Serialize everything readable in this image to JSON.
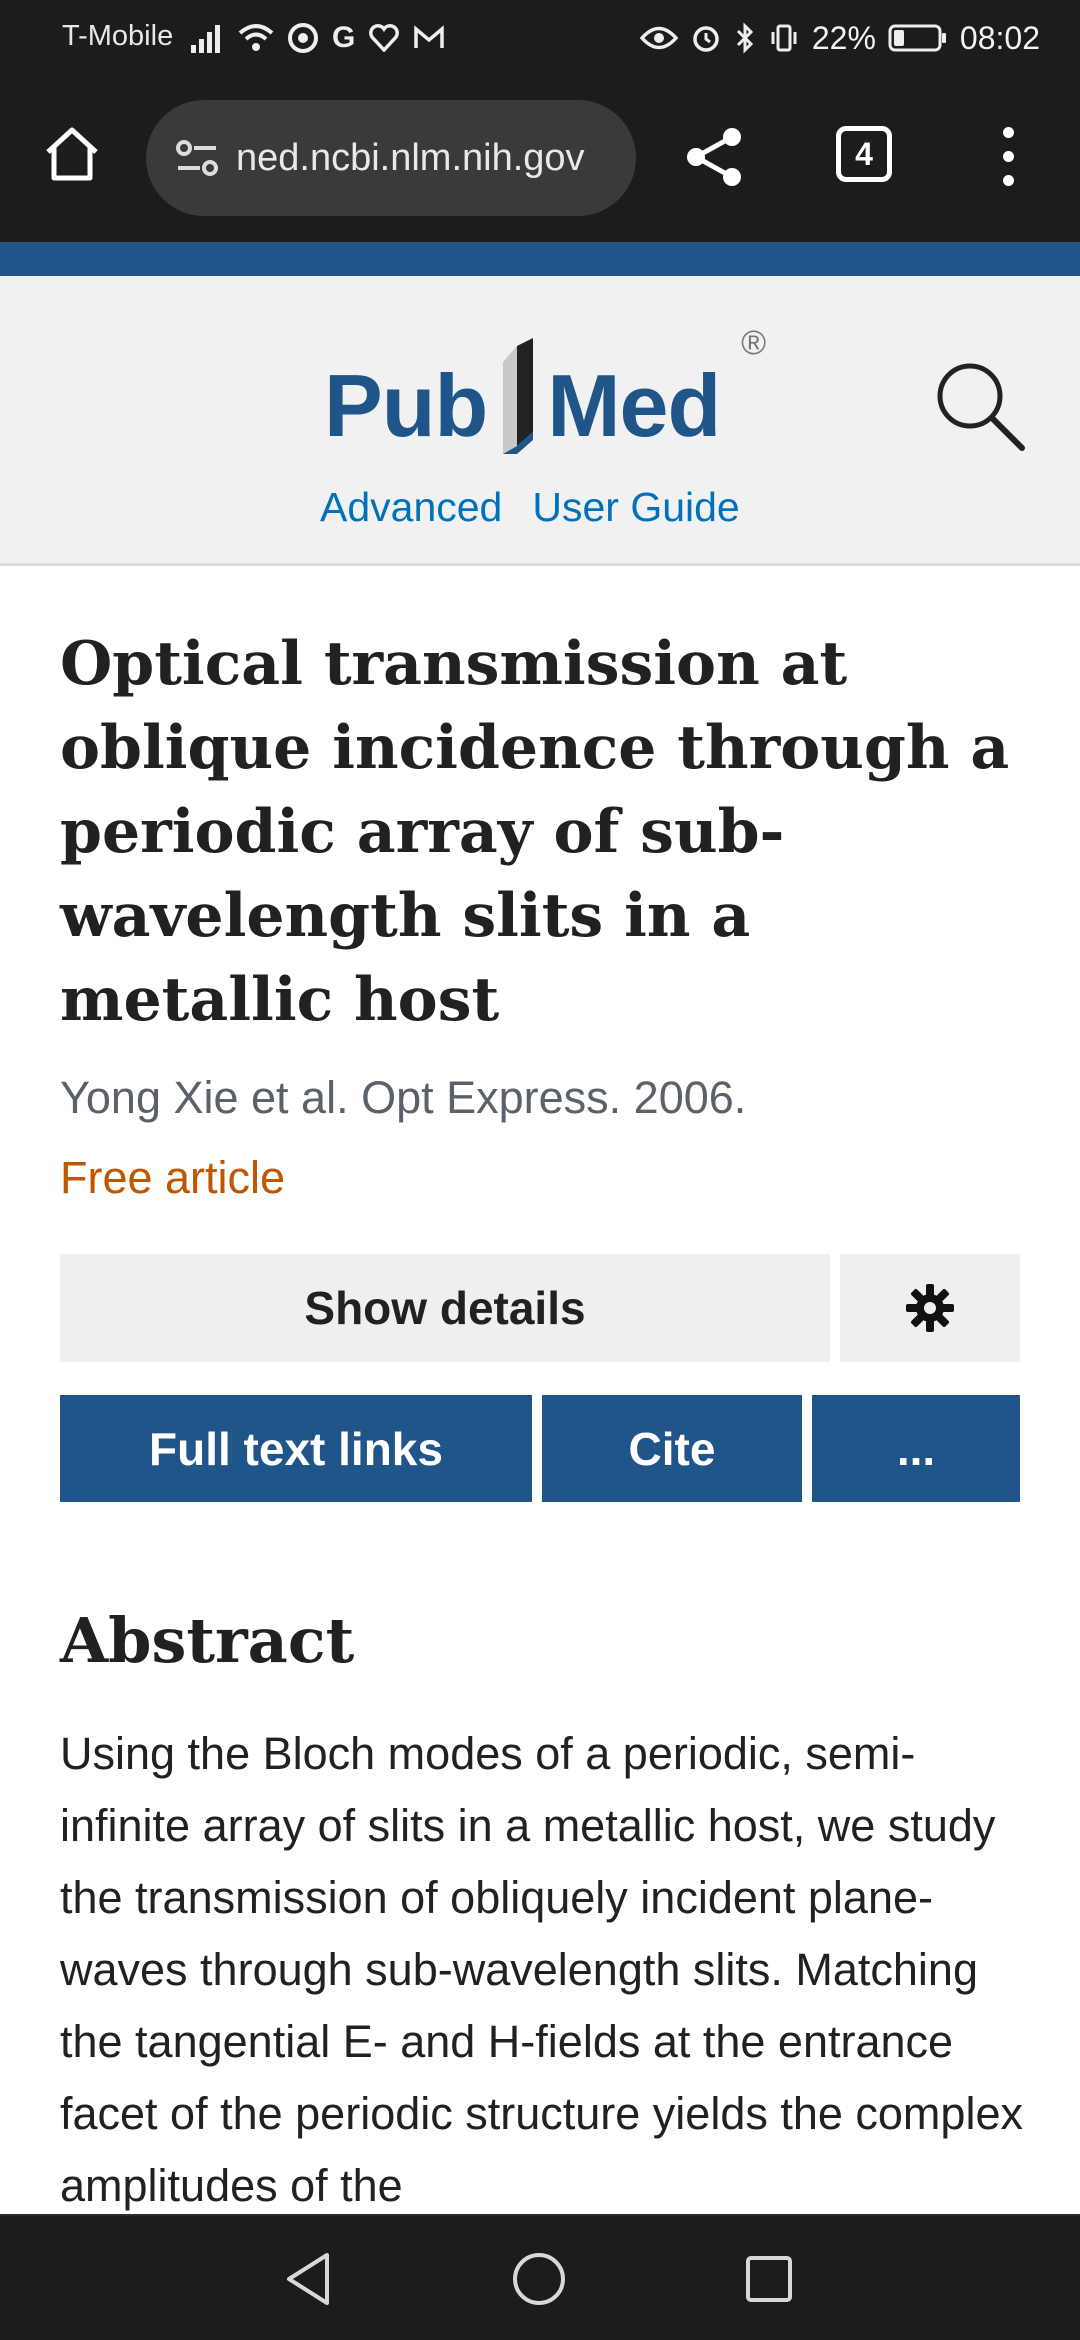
{
  "status_bar": {
    "carrier": "T-Mobile",
    "battery": "22%",
    "time": "08:02"
  },
  "browser": {
    "url": "ned.ncbi.nlm.nih.gov",
    "tab_count": "4"
  },
  "header": {
    "logo_left": "Pub",
    "logo_right": "Med",
    "registered": "®",
    "links": [
      "Advanced",
      "User Guide"
    ]
  },
  "article": {
    "title": "Optical transmission at oblique incidence through a periodic array of sub-wavelength slits in a metallic host",
    "citation": "Yong Xie et al. Opt Express. 2006.",
    "free_label": "Free article"
  },
  "actions": {
    "show_details": "Show details",
    "full_text_links": "Full text links",
    "cite": "Cite",
    "more": "..."
  },
  "abstract": {
    "heading": "Abstract",
    "body": "Using the Bloch modes of a periodic, semi-infinite array of slits in a metallic host, we study the transmission of obliquely incident plane-waves through sub-wavelength slits. Matching the tangential E- and H-fields at the entrance facet of the periodic structure yields the complex amplitudes of the"
  },
  "colors": {
    "brand_blue": "#20558a",
    "link_blue": "#0071bc",
    "free_orange": "#c05600"
  }
}
